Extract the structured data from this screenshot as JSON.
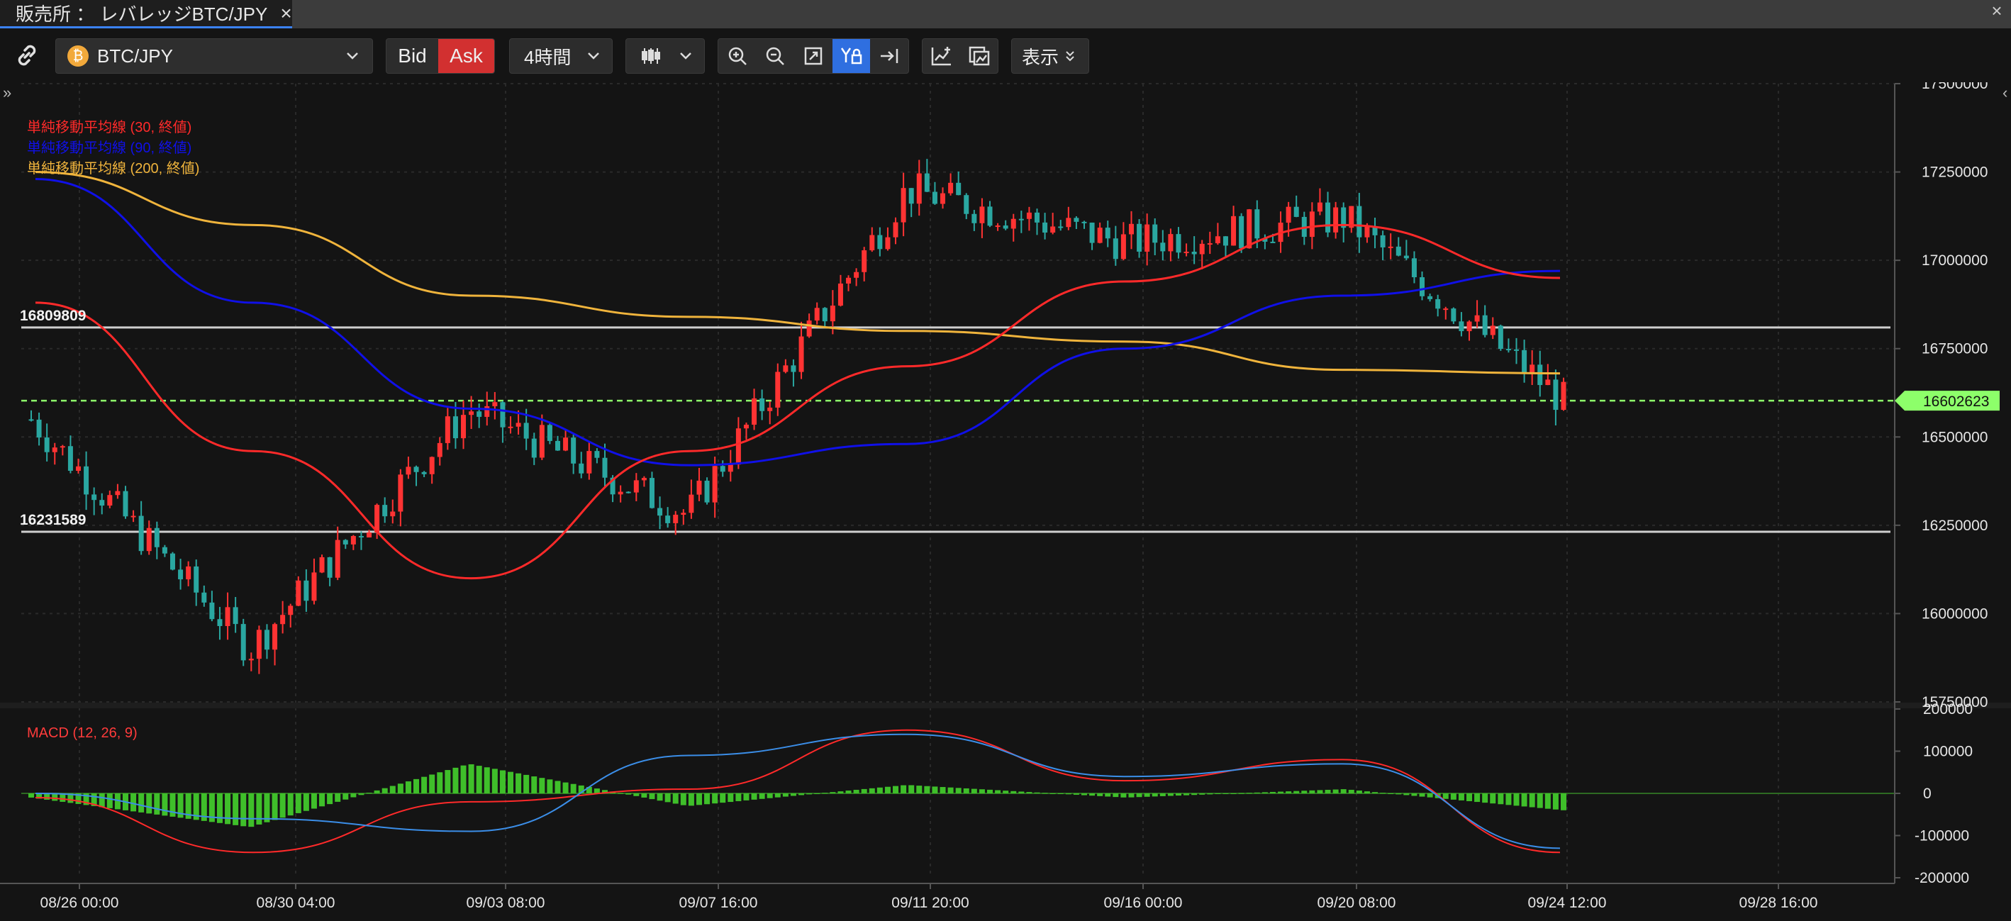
{
  "window": {
    "tab_title": "販売所 ： レバレッジBTC/JPY",
    "tab_close": "×",
    "window_close": "×"
  },
  "toolbar": {
    "symbol": "BTC/JPY",
    "coin_glyph": "₿",
    "bid_label": "Bid",
    "ask_label": "Ask",
    "interval": "4時間",
    "display_label": "表示",
    "icons": [
      "link-icon",
      "candlestick-icon",
      "zoom-in-icon",
      "zoom-out-icon",
      "fit-icon",
      "auto-scale-icon",
      "scroll-to-end-icon",
      "add-indicator-icon",
      "screenshot-icon"
    ]
  },
  "colors": {
    "bg": "#141414",
    "up": "#ff3333",
    "down": "#2aa7a1",
    "sma30": "#ff2a2a",
    "sma90": "#1010e8",
    "sma200": "#f0b43c",
    "macd": "#ff2a2a",
    "signal": "#3b8ee8",
    "hist": "#3fbf2a",
    "current": "#8dff6a"
  },
  "chart_data": [
    {
      "type": "candlestick",
      "symbol": "BTC/JPY",
      "interval": "4時間",
      "ylim": [
        15750000,
        17500000
      ],
      "y_ticks": [
        "15750000",
        "16000000",
        "16250000",
        "16500000",
        "16750000",
        "17000000",
        "17250000",
        "17500000"
      ],
      "x_ticks": [
        "08/26 00:00",
        "08/30 04:00",
        "09/03 08:00",
        "09/07 16:00",
        "09/11 20:00",
        "09/16 00:00",
        "09/20 08:00",
        "09/24 12:00",
        "09/28 16:00"
      ],
      "current_price": "16602623",
      "horizontal_lines": [
        {
          "label": "16809809",
          "value": 16809809
        },
        {
          "label": "16231589",
          "value": 16231589
        }
      ],
      "legend": [
        {
          "name": "単純移動平均線 (30, 終値)",
          "color": "#ff2a2a"
        },
        {
          "name": "単純移動平均線 (90, 終値)",
          "color": "#1010e8"
        },
        {
          "name": "単純移動平均線 (200, 終値)",
          "color": "#f0b43c"
        }
      ],
      "x": [
        "08/26 00:00",
        "08/30 04:00",
        "09/03 08:00",
        "09/07 16:00",
        "09/11 20:00",
        "09/16 00:00",
        "09/20 08:00",
        "09/24 12:00"
      ],
      "close": [
        16550000,
        15900000,
        16580000,
        16280000,
        17200000,
        17050000,
        17120000,
        16602623
      ],
      "sma30": [
        16880000,
        16460000,
        16100000,
        16460000,
        16700000,
        16940000,
        17100000,
        16950000
      ],
      "sma90": [
        17230000,
        16880000,
        16580000,
        16420000,
        16480000,
        16750000,
        16900000,
        16970000
      ],
      "sma200": [
        17250000,
        17100000,
        16900000,
        16840000,
        16800000,
        16770000,
        16690000,
        16680000
      ]
    },
    {
      "type": "line",
      "title": "MACD (12, 26, 9)",
      "ylim": [
        -200000,
        200000
      ],
      "y_ticks": [
        "200000",
        "100000",
        "0",
        "-100000",
        "-200000"
      ],
      "x": [
        "08/26 00:00",
        "08/30 04:00",
        "09/03 08:00",
        "09/07 16:00",
        "09/11 20:00",
        "09/16 00:00",
        "09/20 08:00",
        "09/24 12:00"
      ],
      "series": [
        {
          "values": [
            -10000,
            -140000,
            -20000,
            10000,
            150000,
            30000,
            80000,
            -140000
          ]
        },
        {
          "values": [
            0,
            -60000,
            -90000,
            90000,
            140000,
            40000,
            70000,
            -130000
          ]
        }
      ],
      "histogram": [
        -10000,
        -80000,
        70000,
        -30000,
        20000,
        -10000,
        10000,
        -40000
      ]
    }
  ]
}
